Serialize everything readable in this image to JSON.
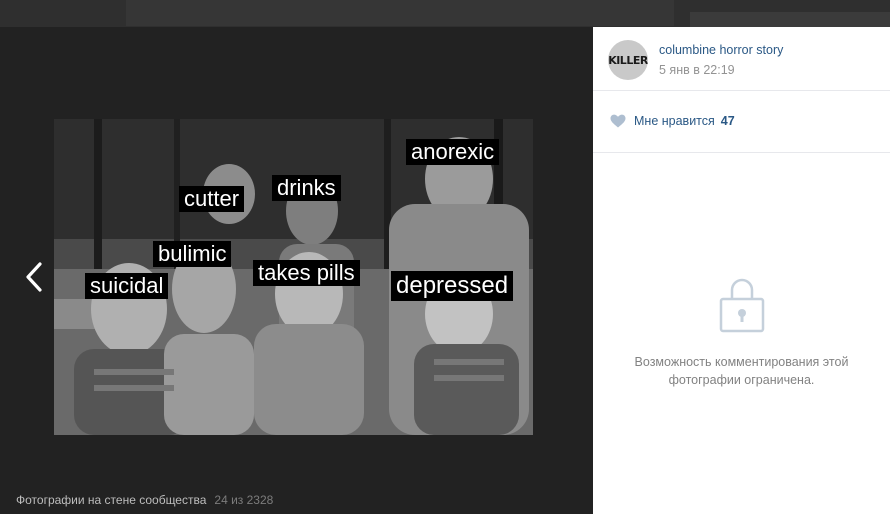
{
  "viewer": {
    "prev_arrow": "chevron-left-icon",
    "photo": {
      "tags": {
        "anorexic": "anorexic",
        "drinks": "drinks",
        "cutter": "cutter",
        "bulimic": "bulimic",
        "suicidal": "suicidal",
        "takes_pills": "takes pills",
        "depressed": "depressed"
      }
    },
    "footer": {
      "album": "Фотографии на стене сообщества",
      "counter": "24 из 2328"
    }
  },
  "sidebar": {
    "avatar_text": "KILLER",
    "author": "columbine horror story",
    "date": "5 янв в 22:19",
    "like": {
      "icon": "heart-icon",
      "label": "Мне нравится",
      "count": "47"
    },
    "comments": {
      "icon": "lock-icon",
      "restricted_text": "Возможность комментирования этой фотографии ограничена."
    }
  },
  "colors": {
    "link": "#2a5885",
    "muted": "#939393",
    "viewer_bg": "#222222",
    "panel_bg": "#ffffff"
  }
}
